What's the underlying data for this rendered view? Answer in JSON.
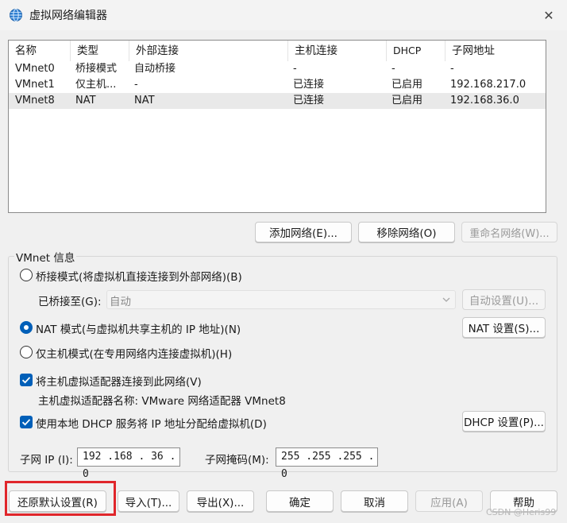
{
  "window": {
    "title": "虚拟网络编辑器",
    "close_symbol": "✕"
  },
  "table": {
    "columns": [
      "名称",
      "类型",
      "外部连接",
      "主机连接",
      "DHCP",
      "子网地址"
    ],
    "rows": [
      {
        "name": "VMnet0",
        "type": "桥接模式",
        "external": "自动桥接",
        "host": "-",
        "dhcp": "-",
        "subnet": "-"
      },
      {
        "name": "VMnet1",
        "type": "仅主机...",
        "external": "-",
        "host": "已连接",
        "dhcp": "已启用",
        "subnet": "192.168.217.0"
      },
      {
        "name": "VMnet8",
        "type": "NAT",
        "external": "NAT",
        "host": "已连接",
        "dhcp": "已启用",
        "subnet": "192.168.36.0",
        "selected": true
      }
    ]
  },
  "network_buttons": {
    "add": "添加网络(E)...",
    "remove": "移除网络(O)",
    "rename": "重命名网络(W)..."
  },
  "vmnet_info": {
    "legend": "VMnet 信息",
    "bridged_radio": "桥接模式(将虚拟机直接连接到外部网络)(B)",
    "bridged_to_label": "已桥接至(G):",
    "bridged_to_value": "自动",
    "auto_settings": "自动设置(U)...",
    "nat_radio": "NAT 模式(与虚拟机共享主机的 IP 地址)(N)",
    "nat_settings": "NAT 设置(S)...",
    "hostonly_radio": "仅主机模式(在专用网络内连接虚拟机)(H)",
    "connect_adapter_check": "将主机虚拟适配器连接到此网络(V)",
    "adapter_name_text": "主机虚拟适配器名称: VMware 网络适配器 VMnet8",
    "dhcp_check": "使用本地 DHCP 服务将 IP 地址分配给虚拟机(D)",
    "dhcp_settings": "DHCP 设置(P)...",
    "selected_mode": "nat",
    "connect_adapter_checked": true,
    "dhcp_checked": true
  },
  "subnet": {
    "ip_label": "子网 IP (I):",
    "ip_value": "192 .168 . 36  .  0",
    "mask_label": "子网掩码(M):",
    "mask_value": "255 .255 .255 .  0"
  },
  "footer_buttons": {
    "restore": "还原默认设置(R)",
    "import": "导入(T)...",
    "export": "导出(X)...",
    "ok": "确定",
    "cancel": "取消",
    "apply": "应用(A)",
    "help": "帮助"
  },
  "watermark": "CSDN @Heris99",
  "colors": {
    "accent": "#005fb8",
    "highlight_box": "#e0262b"
  }
}
